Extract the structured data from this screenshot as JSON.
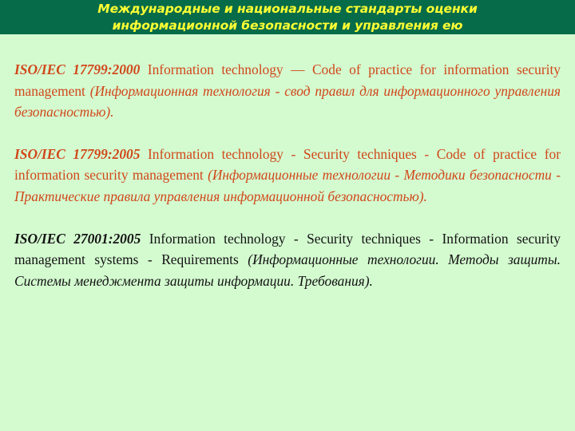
{
  "slide": {
    "background_color": "#d4fbd0",
    "title_band_color": "#066b49",
    "title_color": "#ffff33",
    "accent_text_color": "#d1471a",
    "body_text_color": "#121212",
    "title": {
      "line1": "Международные и национальные стандарты оценки",
      "line2": "информационной безопасности и управления ею"
    },
    "paragraphs": [
      {
        "id": "iso-17799-2000",
        "color": "#d1471a",
        "label": "ISO/IEC 17799:2000",
        "english": " Information technology — Code of practice for information security management ",
        "russian": "(Информационная технология - свод правил для информационного управления безопасностью)."
      },
      {
        "id": "iso-17799-2005",
        "color": "#d1471a",
        "label": "ISO/IEC 17799:2005",
        "english": " Information technology - Security techniques - Code of practice for information security management ",
        "russian": "(Информационные технологии - Методики безопасности - Практические правила управления информационной безопасностью)."
      },
      {
        "id": "iso-27001-2005",
        "color": "#121212",
        "label": "ISO/IEC 27001:2005",
        "english": " Information technology - Security techniques - Information security management systems - Requirements ",
        "russian": "(Информационные технологии. Методы защиты. Системы менеджмента защиты информации. Требования)."
      }
    ]
  }
}
